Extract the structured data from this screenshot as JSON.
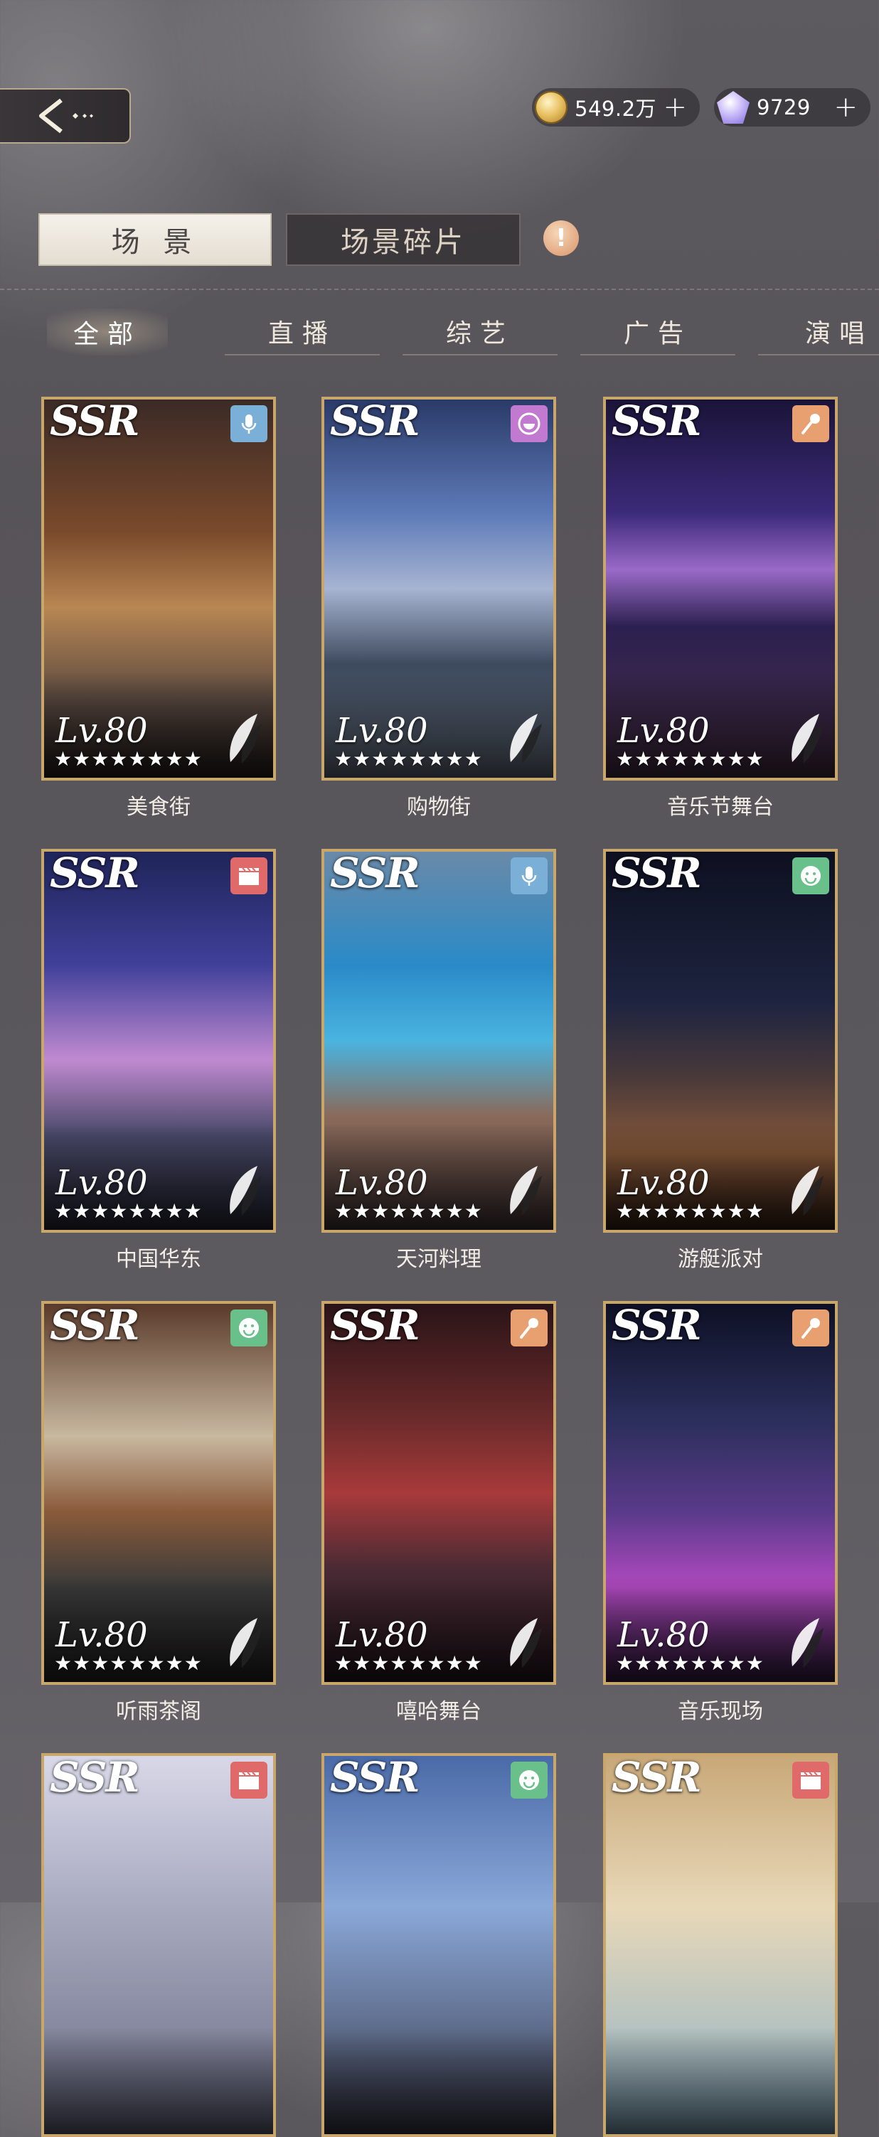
{
  "currency": {
    "gold": {
      "value": "549.2万",
      "plus": "+",
      "icon": "gold-coin-icon"
    },
    "gem": {
      "value": "9729",
      "plus": "+",
      "icon": "diamond-icon"
    }
  },
  "main_tabs": [
    {
      "label": "场 景",
      "active": true
    },
    {
      "label": "场景碎片",
      "active": false
    }
  ],
  "info_icon": "!",
  "sub_tabs": [
    {
      "label": "全部",
      "active": true
    },
    {
      "label": "直播",
      "active": false
    },
    {
      "label": "综艺",
      "active": false
    },
    {
      "label": "广告",
      "active": false
    },
    {
      "label": "演唱",
      "active": false
    }
  ],
  "cards": [
    {
      "rarity": "SSR",
      "level": "Lv.80",
      "stars": "★★★★★★★★",
      "name": "美食街",
      "type": "microphone-icon",
      "badge_color": "#7ab0d8"
    },
    {
      "rarity": "SSR",
      "level": "Lv.80",
      "stars": "★★★★★★★★",
      "name": "购物街",
      "type": "variety-icon",
      "badge_color": "#c27ad0"
    },
    {
      "rarity": "SSR",
      "level": "Lv.80",
      "stars": "★★★★★★★★",
      "name": "音乐节舞台",
      "type": "concert-mic-icon",
      "badge_color": "#e8a070"
    },
    {
      "rarity": "SSR",
      "level": "Lv.80",
      "stars": "★★★★★★★★",
      "name": "中国华东",
      "type": "clapperboard-icon",
      "badge_color": "#e06a6a"
    },
    {
      "rarity": "SSR",
      "level": "Lv.80",
      "stars": "★★★★★★★★",
      "name": "天河料理",
      "type": "microphone-icon",
      "badge_color": "#7ab0d8"
    },
    {
      "rarity": "SSR",
      "level": "Lv.80",
      "stars": "★★★★★★★★",
      "name": "游艇派对",
      "type": "smile-icon",
      "badge_color": "#6ac08a"
    },
    {
      "rarity": "SSR",
      "level": "Lv.80",
      "stars": "★★★★★★★★",
      "name": "听雨茶阁",
      "type": "smile-icon",
      "badge_color": "#6ac08a"
    },
    {
      "rarity": "SSR",
      "level": "Lv.80",
      "stars": "★★★★★★★★",
      "name": "嘻哈舞台",
      "type": "concert-mic-icon",
      "badge_color": "#e8a070"
    },
    {
      "rarity": "SSR",
      "level": "Lv.80",
      "stars": "★★★★★★★★",
      "name": "音乐现场",
      "type": "concert-mic-icon",
      "badge_color": "#e8a070"
    },
    {
      "rarity": "SSR",
      "type": "clapperboard-icon",
      "badge_color": "#e06a6a"
    },
    {
      "rarity": "SSR",
      "type": "smile-icon",
      "badge_color": "#6ac08a"
    },
    {
      "rarity": "SSR",
      "type": "clapperboard-icon",
      "badge_color": "#e06a6a"
    }
  ]
}
